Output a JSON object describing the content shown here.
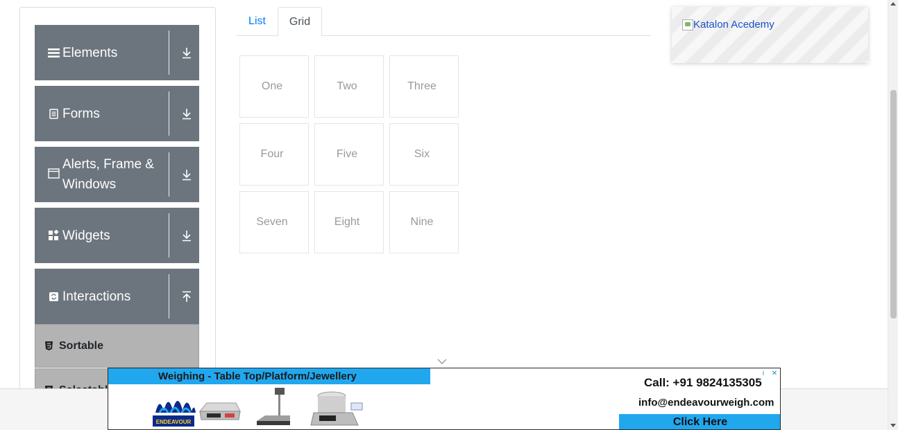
{
  "sidebar": {
    "groups": [
      {
        "label": "Elements",
        "icon": "menu-icon",
        "arrow": "download-arrow-icon"
      },
      {
        "label": "Forms",
        "icon": "document-icon",
        "arrow": "download-arrow-icon"
      },
      {
        "label": "Alerts, Frame & Windows",
        "icon": "window-icon",
        "arrow": "download-arrow-icon"
      },
      {
        "label": "Widgets",
        "icon": "widgets-icon",
        "arrow": "download-arrow-icon"
      },
      {
        "label": "Interactions",
        "icon": "refresh-icon",
        "arrow": "upload-arrow-icon"
      }
    ],
    "submenu": [
      {
        "label": "Sortable",
        "icon": "html5-icon"
      },
      {
        "label": "Selectable",
        "icon": "html5-icon"
      }
    ]
  },
  "tabs": [
    {
      "label": "List",
      "active": false
    },
    {
      "label": "Grid",
      "active": true
    }
  ],
  "grid": {
    "cells": [
      "One",
      "Two",
      "Three",
      "Four",
      "Five",
      "Six",
      "Seven",
      "Eight",
      "Nine"
    ]
  },
  "katalon_ad": {
    "alt_text": "Katalon Acedemy"
  },
  "banner_ad": {
    "headline": "Weighing - Table Top/Platform/Jewellery",
    "phone": "Call: +91 9824135305",
    "email": "info@endeavourweigh.com",
    "cta": "Click Here",
    "brand": "ENDEAVOUR",
    "badge_info": "i",
    "badge_close": "✕"
  },
  "colors": {
    "accordion_bg": "#6c757d",
    "submenu_bg": "#b3b3b3",
    "tab_active_text": "#495057",
    "tab_link": "#007bff",
    "banner_accent": "#21a7ee"
  }
}
